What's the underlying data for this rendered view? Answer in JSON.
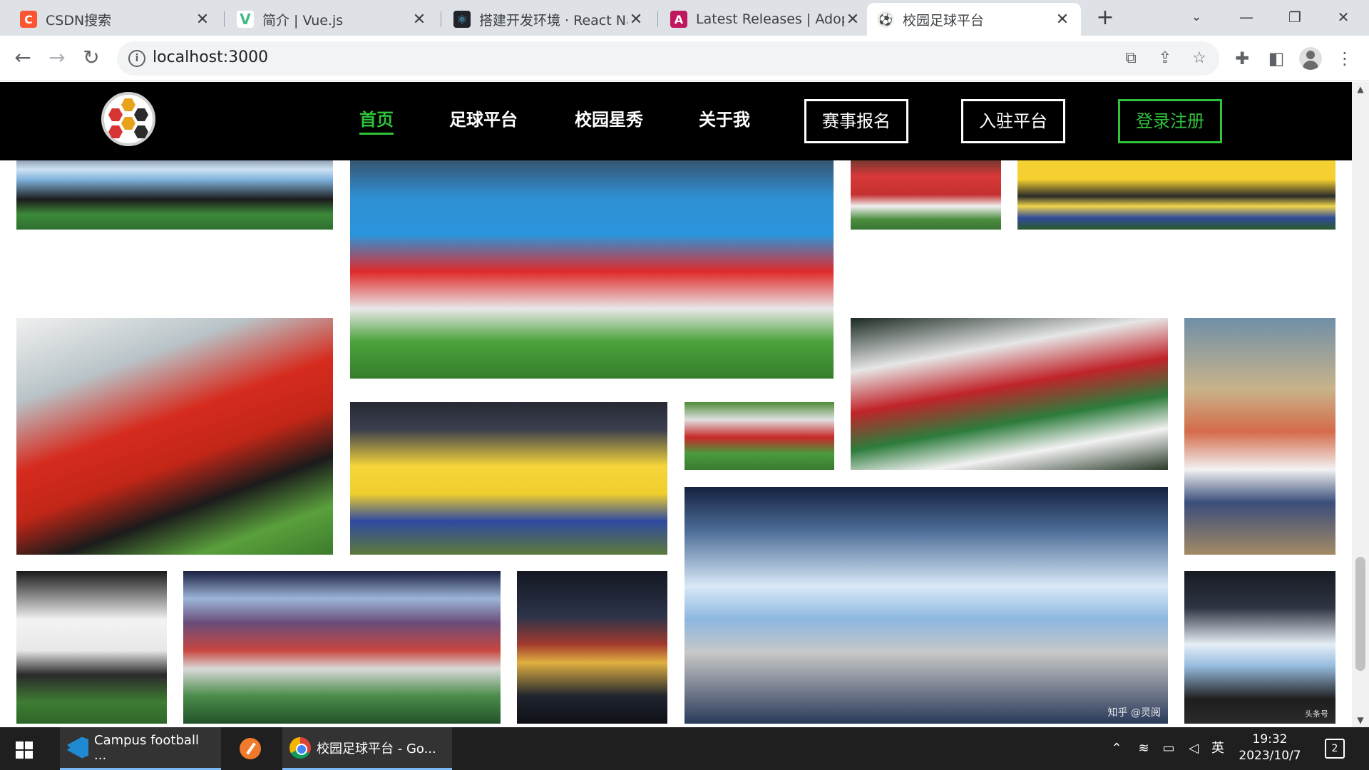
{
  "browser": {
    "tabs": [
      {
        "title": "CSDN搜索",
        "favicon": "csdn-icon",
        "color": "#fc5531",
        "glyph": "C"
      },
      {
        "title": "简介 | Vue.js",
        "favicon": "vue-icon",
        "color": "#42b883",
        "glyph": "V"
      },
      {
        "title": "搭建开发环境 · React Na",
        "favicon": "react-icon",
        "color": "#20232a",
        "glyph": "⚛"
      },
      {
        "title": "Latest Releases | Adopt",
        "favicon": "adoptium-icon",
        "color": "#c0185e",
        "glyph": "A"
      },
      {
        "title": "校园足球平台",
        "favicon": "site-icon",
        "color": "#e0e0e0",
        "glyph": "⚽",
        "active": true
      }
    ],
    "new_tab_label": "+",
    "url": "localhost:3000"
  },
  "site": {
    "nav": {
      "home": "首页",
      "football_platform": "足球平台",
      "campus_stars": "校园星秀",
      "about_me": "关于我",
      "event_signup": "赛事报名",
      "join_platform": "入驻平台",
      "login_register": "登录注册"
    },
    "accent_color": "#30c23a",
    "photo_wall": [
      {
        "name": "argentina-team-photo"
      },
      {
        "name": "russia-celebration-photo"
      },
      {
        "name": "peru-team-photo"
      },
      {
        "name": "brazil-trophy-photo"
      },
      {
        "name": "spain-celebration-photo"
      },
      {
        "name": "brazil-team-photo"
      },
      {
        "name": "red-team-action-photo"
      },
      {
        "name": "iran-celebration-photo"
      },
      {
        "name": "cartoon-players-illustration"
      },
      {
        "name": "germany-team-photo"
      },
      {
        "name": "world-cup-teams-illustration"
      },
      {
        "name": "players-lineup-illustration"
      },
      {
        "name": "argentina-copa-america-photo",
        "watermark": "知乎 @灵阅"
      },
      {
        "name": "argentina-players-photo",
        "watermark": "头条号"
      }
    ]
  },
  "taskbar": {
    "apps": [
      {
        "label": "Campus football ...",
        "icon": "vscode-icon"
      },
      {
        "label": "",
        "icon": "paint-icon"
      },
      {
        "label": "校园足球平台 - Go...",
        "icon": "chrome-icon"
      }
    ],
    "ime": "英",
    "time": "19:32",
    "date": "2023/10/7",
    "notification_count": "2"
  }
}
